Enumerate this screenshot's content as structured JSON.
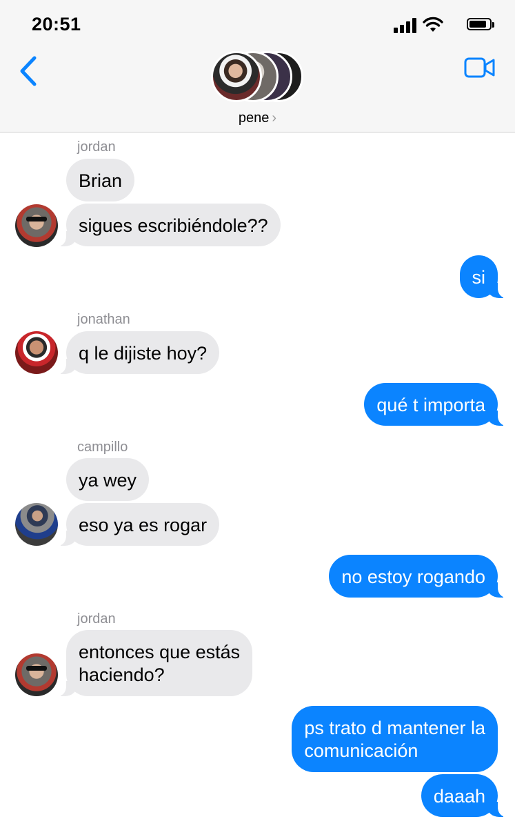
{
  "status_bar": {
    "time": "20:51"
  },
  "header": {
    "group_name": "pene",
    "chevron": "›"
  },
  "messages": [
    {
      "sender": "jordan",
      "texts": [
        "Brian",
        "sigues escribiéndole??"
      ]
    },
    {
      "outgoing": [
        "si"
      ]
    },
    {
      "sender": "jonathan",
      "texts": [
        "q le dijiste hoy?"
      ]
    },
    {
      "outgoing": [
        "qué t importa"
      ]
    },
    {
      "sender": "campillo",
      "texts": [
        "ya wey",
        "eso ya es rogar"
      ]
    },
    {
      "outgoing": [
        "no estoy rogando"
      ]
    },
    {
      "sender": "jordan",
      "texts": [
        "entonces que estás",
        "haciendo?"
      ]
    },
    {
      "outgoing": [
        "ps trato d mantener la",
        "comunicación",
        "daaah"
      ]
    }
  ],
  "colors": {
    "outgoing_bubble": "#0b84ff",
    "incoming_bubble": "#e9e9eb",
    "accent": "#0b84ff",
    "header_bg": "#f6f6f6"
  },
  "icons": [
    "back-chevron-icon",
    "video-camera-icon",
    "signal-icon",
    "wifi-icon",
    "battery-icon"
  ]
}
